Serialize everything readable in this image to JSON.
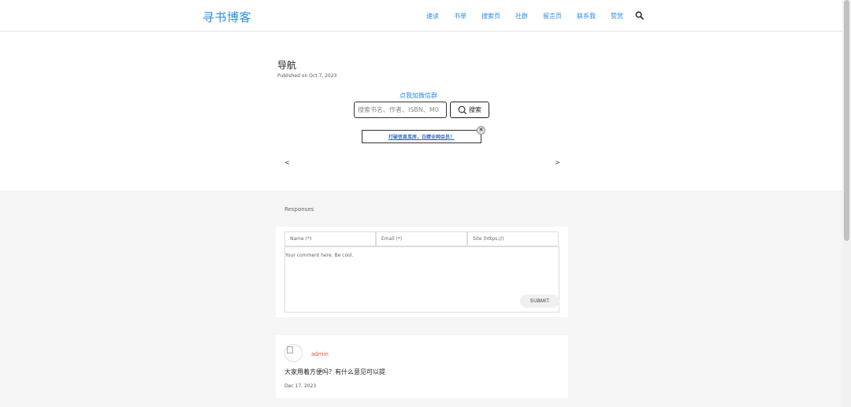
{
  "header": {
    "logo": "寻书博客",
    "nav": [
      {
        "label": "速读"
      },
      {
        "label": "书单"
      },
      {
        "label": "搜索页"
      },
      {
        "label": "社群"
      },
      {
        "label": "留言页"
      },
      {
        "label": "联系我"
      },
      {
        "label": "赞赏"
      }
    ],
    "search_icon": "search-icon"
  },
  "post": {
    "title": "导航",
    "published": "Published on Oct 7, 2023",
    "wechat_link": "点我加微信群",
    "search_placeholder": "搜索书名、作者、ISBN、M0",
    "search_button": "搜索",
    "banner_text": "打破信息茧房，白嫖全网会员！",
    "close_symbol": "✕",
    "prev_arrow": "<",
    "next_arrow": ">"
  },
  "responses": {
    "label": "Responses",
    "form": {
      "name_placeholder": "Name (*)",
      "email_placeholder": "Email (*)",
      "site_placeholder": "Site (https://)",
      "comment_placeholder": "Your comment here. Be cool.",
      "submit_label": "SUBMIT"
    },
    "comments": [
      {
        "author": "admin",
        "text": "大家用着方便吗？有什么意见可以提",
        "date": "Dec 17, 2023"
      }
    ]
  },
  "colors": {
    "accent": "#2d8ce8",
    "author": "#e74c3c",
    "background": "#f5f5f5"
  }
}
